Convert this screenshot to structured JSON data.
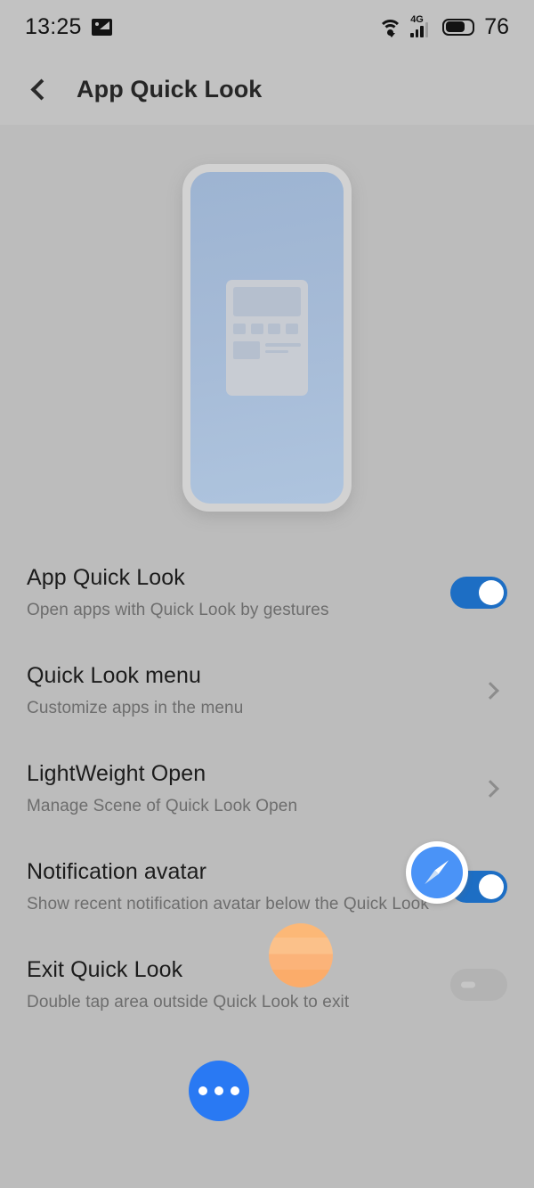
{
  "status_bar": {
    "time": "13:25",
    "photo_icon": "image-icon",
    "wifi_icon": "wifi-icon",
    "signal_icon": "signal-4g-icon",
    "signal_label": "4G",
    "battery_icon": "battery-icon",
    "battery_level": "76"
  },
  "app_bar": {
    "back_icon": "back-chevron-icon",
    "title": "App Quick Look"
  },
  "hero": {
    "illustration_name": "phone-quick-look-illustration"
  },
  "settings": [
    {
      "title": "App Quick Look",
      "subtitle": "Open apps with Quick Look by gestures",
      "control": "toggle",
      "state": "on"
    },
    {
      "title": "Quick Look menu",
      "subtitle": "Customize apps in the menu",
      "control": "chevron",
      "state": ""
    },
    {
      "title": "LightWeight Open",
      "subtitle": "Manage Scene of Quick Look Open",
      "control": "chevron",
      "state": ""
    },
    {
      "title": "Notification avatar",
      "subtitle": "Show recent notification avatar below the Quick Look",
      "control": "toggle",
      "state": "on"
    },
    {
      "title": "Exit Quick Look",
      "subtitle": "Double tap area outside Quick Look to exit",
      "control": "toggle",
      "state": "off"
    }
  ],
  "overlay": {
    "compass_icon": "safari-compass-icon",
    "blob_icon": "orange-circle-icon",
    "more_icon": "more-dots-icon"
  },
  "colors": {
    "accent_blue": "#2979f3",
    "toggle_on": "#1d6ec4",
    "toggle_off": "#b3b3b3",
    "compass_blue": "#4a93f7",
    "blob_orange": "#fcb877",
    "background": "#bcbcbc"
  }
}
